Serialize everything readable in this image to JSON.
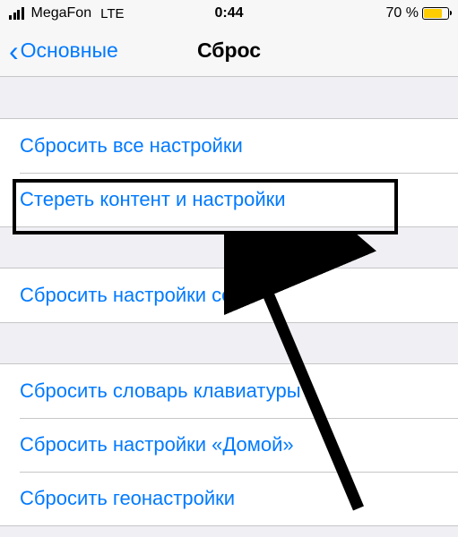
{
  "status_bar": {
    "carrier": "MegaFon",
    "network": "LTE",
    "time": "0:44",
    "battery_percent": "70 %"
  },
  "nav": {
    "back_label": "Основные",
    "title": "Сброс"
  },
  "groups": [
    {
      "items": [
        {
          "label": "Сбросить все настройки"
        },
        {
          "label": "Стереть контент и настройки"
        }
      ]
    },
    {
      "items": [
        {
          "label": "Сбросить настройки сети"
        }
      ]
    },
    {
      "items": [
        {
          "label": "Сбросить словарь клавиатуры"
        },
        {
          "label": "Сбросить настройки «Домой»"
        },
        {
          "label": "Сбросить геонастройки"
        }
      ]
    }
  ]
}
